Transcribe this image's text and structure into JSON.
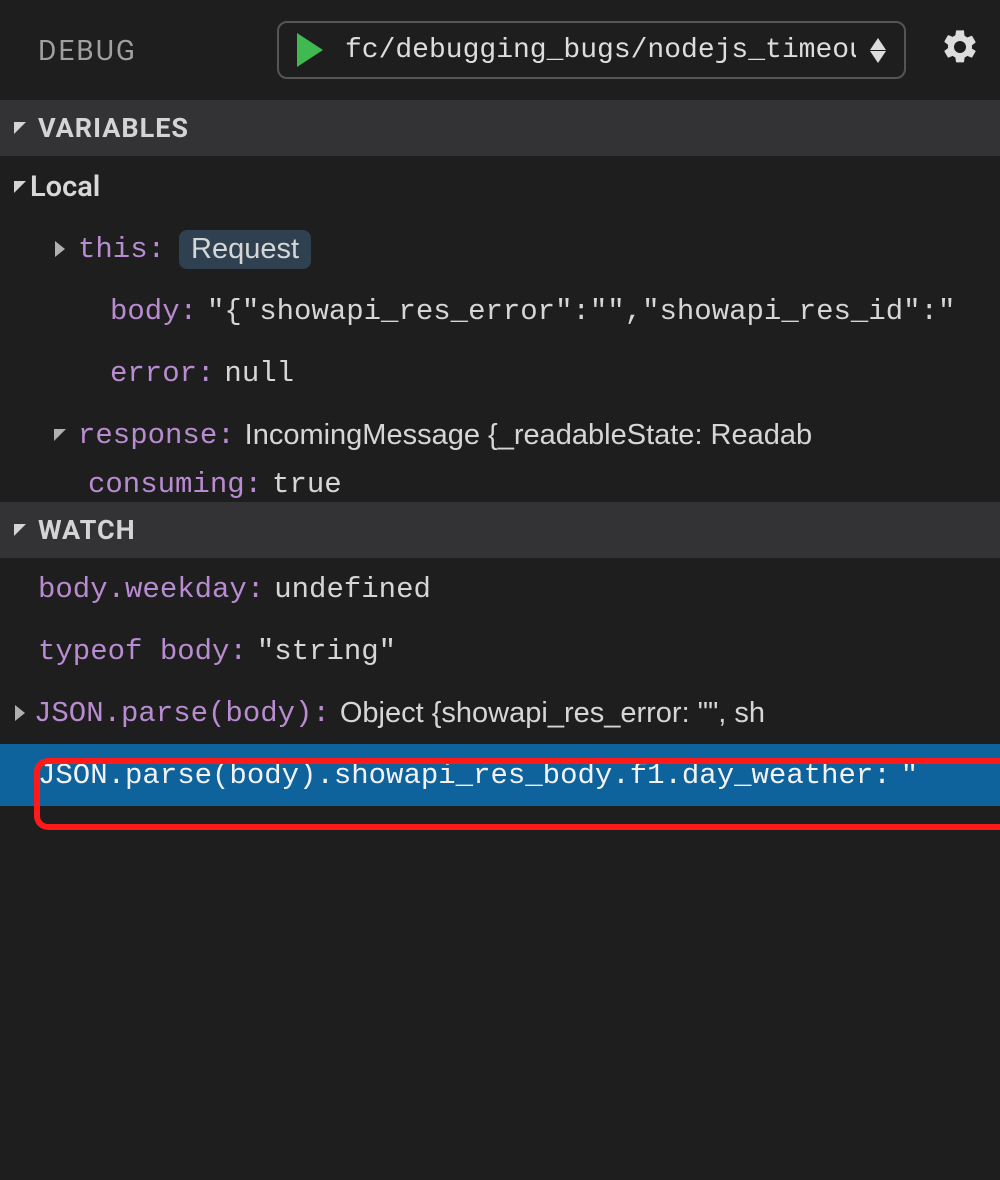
{
  "header": {
    "title": "DEBUG",
    "config": "fc/debugging_bugs/nodejs_timeout"
  },
  "sections": {
    "variables": "VARIABLES",
    "watch": "WATCH"
  },
  "scopes": {
    "local": "Local"
  },
  "vars": {
    "this": {
      "name": "this",
      "value": "Request"
    },
    "body": {
      "name": "body",
      "value": "\"{\"showapi_res_error\":\"\",\"showapi_res_id\":\""
    },
    "error": {
      "name": "error",
      "value": "null"
    },
    "response": {
      "name": "response",
      "value": "IncomingMessage {_readableState: Readab"
    },
    "consuming": {
      "name": "consuming",
      "value": "true"
    }
  },
  "watch": [
    {
      "name": "body.weekday",
      "value": "undefined",
      "expandable": false
    },
    {
      "name": "typeof body",
      "value": "\"string\"",
      "type": "str",
      "expandable": false
    },
    {
      "name": "JSON.parse(body)",
      "value": "Object {showapi_res_error: \"\", sh",
      "expandable": true
    },
    {
      "name": "JSON.parse(body).showapi_res_body.f1.day_weather",
      "value": "\"",
      "type": "str",
      "expandable": false,
      "selected": true
    }
  ]
}
